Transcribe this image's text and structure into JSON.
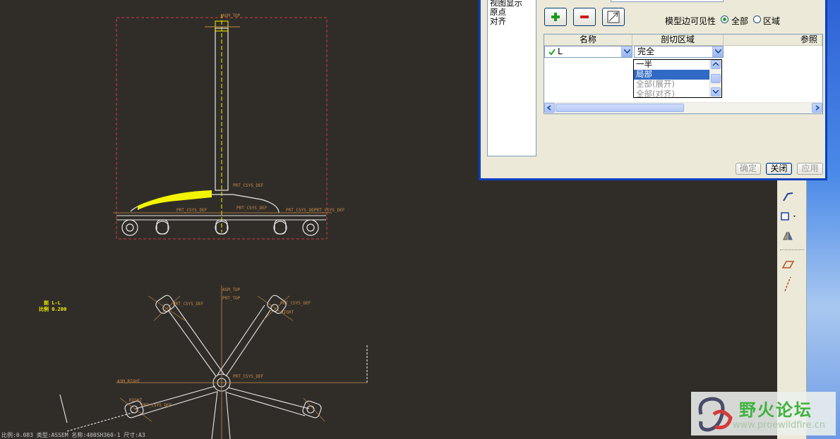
{
  "dialog": {
    "left_list": [
      "视图显示",
      "原点",
      "对齐"
    ],
    "buttons": {
      "add": "+",
      "remove": "−"
    },
    "visibility": {
      "label": "模型边可见性",
      "options": [
        "全部",
        "区域"
      ],
      "selected": "全部"
    },
    "table": {
      "headers": [
        "名称",
        "剖切区域",
        "参照"
      ],
      "rows": [
        {
          "name": "L",
          "region": "完全"
        }
      ]
    },
    "dropdown_options": [
      {
        "label": "一半",
        "state": "normal"
      },
      {
        "label": "局部",
        "state": "selected"
      },
      {
        "label": "全部(展开)",
        "state": "disabled"
      },
      {
        "label": "全部(对齐)",
        "state": "disabled"
      }
    ],
    "footer": {
      "ok": "确定",
      "close": "关闭",
      "apply": "应用"
    }
  },
  "drawing": {
    "top_view_labels": [
      "ASM_TOP",
      "PRT_CSYS_DEF",
      "PRT_CSYS_DEF",
      "PRT_CSYS_DEF",
      "PRT_CSYS_DEF",
      "PRT_CSYS_DEF"
    ],
    "bottom_view_labels": [
      "ASM_TOP",
      "PRT_TOP",
      "PRT_CSYS_DEF",
      "PRT_CSYS_DEF",
      "ASM_RIGHT",
      "PRT_CSYS_DEF",
      "PRT_CSYS_DEF",
      "RIGHT",
      "RIGHT"
    ],
    "section_note": [
      "剖 L-L",
      "比例 0.200"
    ],
    "status_bar": "比例:0.083    类型:ASSEM    名称:400SH360-1    尺寸:A3"
  },
  "watermark": {
    "title": "野火论坛",
    "url": "www.proewildfire.cn"
  },
  "colors": {
    "accent_yellow": "#f4f400",
    "annotation_orange": "#c98a45",
    "dialog_border": "#0a3fbf"
  }
}
